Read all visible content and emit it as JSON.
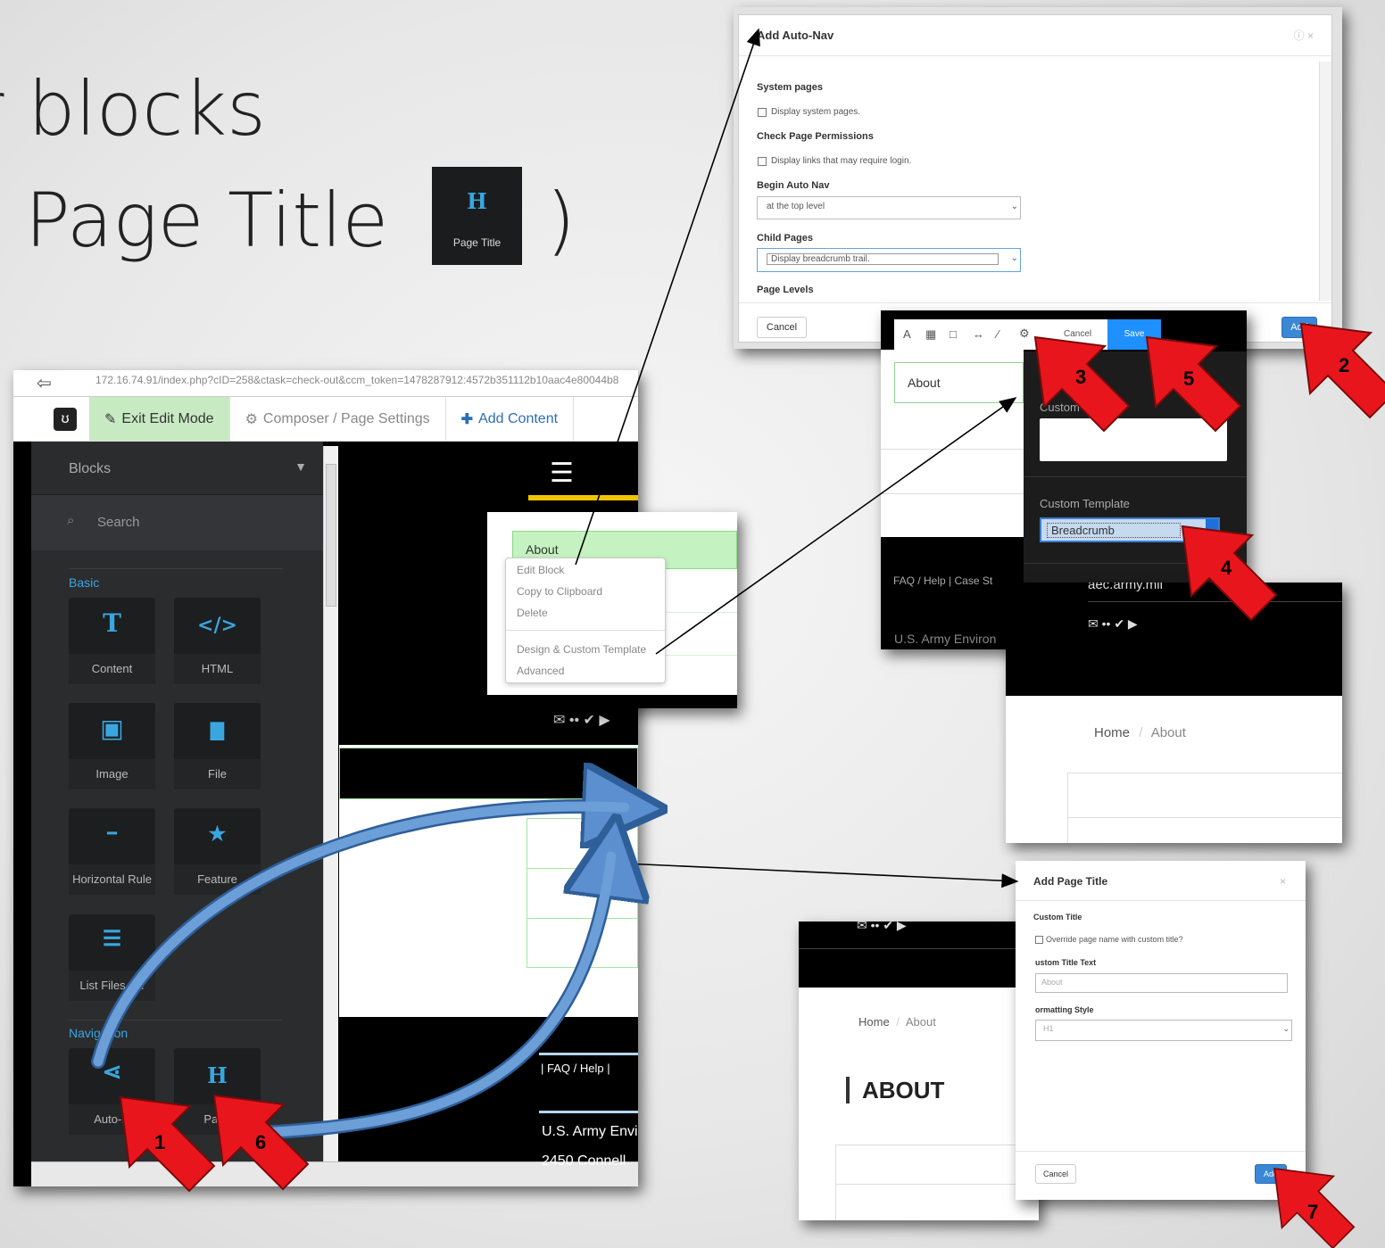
{
  "slide": {
    "title_line1": "r blocks",
    "title_line2": "Page Title",
    "title_close": ")",
    "chip_icon": "H",
    "chip_label": "Page Title"
  },
  "browser": {
    "url": "172.16.74.91/index.php?cID=258&ctask=check-out&ccm_token=1478287912:4572b351112b10aac4e80044b8",
    "toolbar": {
      "exit": "Exit Edit Mode",
      "composer": "Composer / Page Settings",
      "add": "Add Content"
    },
    "panel": {
      "header": "Blocks",
      "search_placeholder": "Search",
      "basic": "Basic",
      "navigation": "Navigation",
      "tiles": [
        {
          "icon": "T",
          "label": "Content"
        },
        {
          "icon": "</>",
          "label": "HTML"
        },
        {
          "icon": "▣",
          "label": "Image"
        },
        {
          "icon": "▇",
          "label": "File"
        },
        {
          "icon": "━",
          "label": "Horizontal Rule"
        },
        {
          "icon": "★",
          "label": "Feature"
        },
        {
          "icon": "☰",
          "label": "List Files F..."
        }
      ],
      "nav_tiles": [
        {
          "icon": "⋖",
          "label": "Auto-N"
        },
        {
          "icon": "H",
          "label": "Page"
        }
      ]
    },
    "site": {
      "footer_link": "FAQ / Help",
      "footer_org": "U.S. Army Envi",
      "footer_addr": "2450 Connell"
    }
  },
  "context_menu": {
    "item_label": "About",
    "items": [
      "Edit Block",
      "Copy to Clipboard",
      "Delete",
      "Design & Custom Template",
      "Advanced"
    ]
  },
  "autonav": {
    "title": "Add Auto-Nav",
    "sys": "System pages",
    "sys_cb": "Display system pages.",
    "perm": "Check Page Permissions",
    "perm_cb": "Display links that may require login.",
    "begin": "Begin Auto Nav",
    "begin_val": "at the top level",
    "child": "Child Pages",
    "child_val": "Display breadcrumb trail.",
    "levels": "Page Levels",
    "cancel": "Cancel",
    "add": "Add"
  },
  "design": {
    "cancel": "Cancel",
    "save": "Save",
    "block_text": "About",
    "panel_title": "Ad",
    "custom_label": "Custom C",
    "template_label": "Custom Template",
    "template_val": "Breadcrumb",
    "footer_link": "FAQ / Help | Case St",
    "org": "U.S. Army Environ"
  },
  "breadcrumb_shot": {
    "domain": "aec.army.mil",
    "home": "Home",
    "sep": "/",
    "about": "About"
  },
  "pagetitle": {
    "title": "Add Page Title",
    "close": "×",
    "custom_title": "Custom Title",
    "override": "Override page name with custom title?",
    "ct_text": "ustom Title Text",
    "ct_val": "About",
    "fmt": "ormatting Style",
    "fmt_val": "H1",
    "cancel": "Cancel",
    "add": "Add"
  },
  "result": {
    "home": "Home",
    "sep": "/",
    "about": "About",
    "heading": "ABOUT"
  },
  "steps": [
    "1",
    "2",
    "3",
    "4",
    "5",
    "6",
    "7"
  ]
}
